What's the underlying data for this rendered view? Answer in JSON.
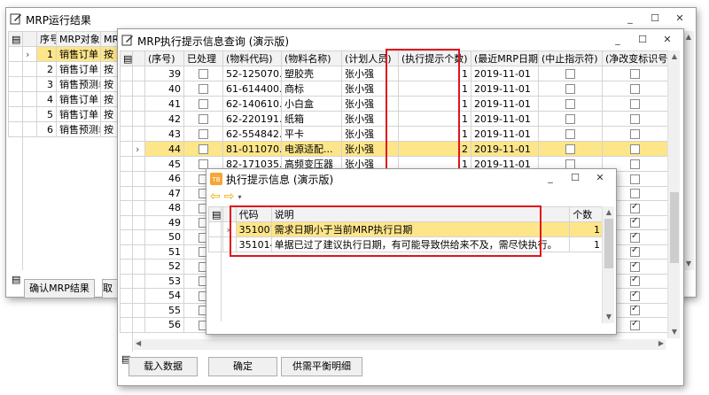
{
  "win1": {
    "title": "MRP运行结果",
    "columns": [
      "序号",
      "MRP对象",
      "MR"
    ],
    "rows": [
      {
        "no": "1",
        "obj": "销售订单",
        "c3": "按"
      },
      {
        "no": "2",
        "obj": "销售订单",
        "c3": "按"
      },
      {
        "no": "3",
        "obj": "销售预测单",
        "c3": "按"
      },
      {
        "no": "4",
        "obj": "销售订单",
        "c3": "按"
      },
      {
        "no": "5",
        "obj": "销售订单",
        "c3": "按"
      },
      {
        "no": "6",
        "obj": "销售预测单",
        "c3": "按"
      }
    ],
    "btn_confirm": "确认MRP结果",
    "btn_cancel": "取"
  },
  "win2": {
    "title": "MRP执行提示信息查询 (演示版)",
    "columns": [
      "(序号)",
      "已处理",
      "(物料代码)",
      "(物料名称)",
      "(计划人员)",
      "(执行提示个数)",
      "(最近MRP日期)",
      "(中止指示符)",
      "(净改变标识号)"
    ],
    "rows": [
      {
        "no": "39",
        "code": "52-125070...",
        "name": "塑胶壳",
        "planner": "张小强",
        "count": "1",
        "date": "2019-11-01",
        "chk2": false
      },
      {
        "no": "40",
        "code": "61-614400...",
        "name": "商标",
        "planner": "张小强",
        "count": "1",
        "date": "2019-11-01",
        "chk2": false
      },
      {
        "no": "41",
        "code": "62-140610...",
        "name": "小白盒",
        "planner": "张小强",
        "count": "1",
        "date": "2019-11-01",
        "chk2": false
      },
      {
        "no": "42",
        "code": "62-220191...",
        "name": "纸箱",
        "planner": "张小强",
        "count": "1",
        "date": "2019-11-01",
        "chk2": false
      },
      {
        "no": "43",
        "code": "62-554842...",
        "name": "平卡",
        "planner": "张小强",
        "count": "1",
        "date": "2019-11-01",
        "chk2": false
      },
      {
        "no": "44",
        "code": "81-011070...",
        "name": "电源适配...",
        "planner": "张小强",
        "count": "2",
        "date": "2019-11-01",
        "chk2": false
      },
      {
        "no": "45",
        "code": "82-171035...",
        "name": "高频变压器",
        "planner": "张小强",
        "count": "1",
        "date": "2019-11-01",
        "chk2": false
      },
      {
        "no": "46",
        "code": "",
        "name": "",
        "planner": "",
        "count": "",
        "date": "",
        "chk2": false
      },
      {
        "no": "47",
        "code": "",
        "name": "",
        "planner": "",
        "count": "",
        "date": "",
        "chk2": false
      },
      {
        "no": "48",
        "code": "",
        "name": "",
        "planner": "",
        "count": "",
        "date": "",
        "chk2": true
      },
      {
        "no": "49",
        "code": "",
        "name": "",
        "planner": "",
        "count": "",
        "date": "",
        "chk2": true
      },
      {
        "no": "50",
        "code": "",
        "name": "",
        "planner": "",
        "count": "",
        "date": "",
        "chk2": true
      },
      {
        "no": "51",
        "code": "",
        "name": "",
        "planner": "",
        "count": "",
        "date": "",
        "chk2": true
      },
      {
        "no": "52",
        "code": "",
        "name": "",
        "planner": "",
        "count": "",
        "date": "",
        "chk2": true
      },
      {
        "no": "53",
        "code": "",
        "name": "",
        "planner": "",
        "count": "",
        "date": "",
        "chk2": true
      },
      {
        "no": "54",
        "code": "",
        "name": "",
        "planner": "",
        "count": "",
        "date": "",
        "chk2": true
      },
      {
        "no": "55",
        "code": "",
        "name": "",
        "planner": "",
        "count": "",
        "date": "",
        "chk2": true
      },
      {
        "no": "56",
        "code": "",
        "name": "",
        "planner": "",
        "count": "",
        "date": "",
        "chk2": true
      }
    ],
    "btn_load": "载入数据",
    "btn_ok": "确定",
    "btn_balance": "供需平衡明细"
  },
  "win3": {
    "title": "执行提示信息 (演示版)",
    "columns": [
      "代码",
      "说明",
      "个数"
    ],
    "rows": [
      {
        "code": "351007",
        "desc": "需求日期小于当前MRP执行日期",
        "count": "1"
      },
      {
        "code": "351014",
        "desc": "单据已过了建议执行日期，有可能导致供给来不及，需尽快执行。",
        "count": "1"
      }
    ]
  },
  "colors": {
    "highlight": "#fde58a",
    "annotation": "#e0141e",
    "nav_arrow": "#f0a800"
  }
}
